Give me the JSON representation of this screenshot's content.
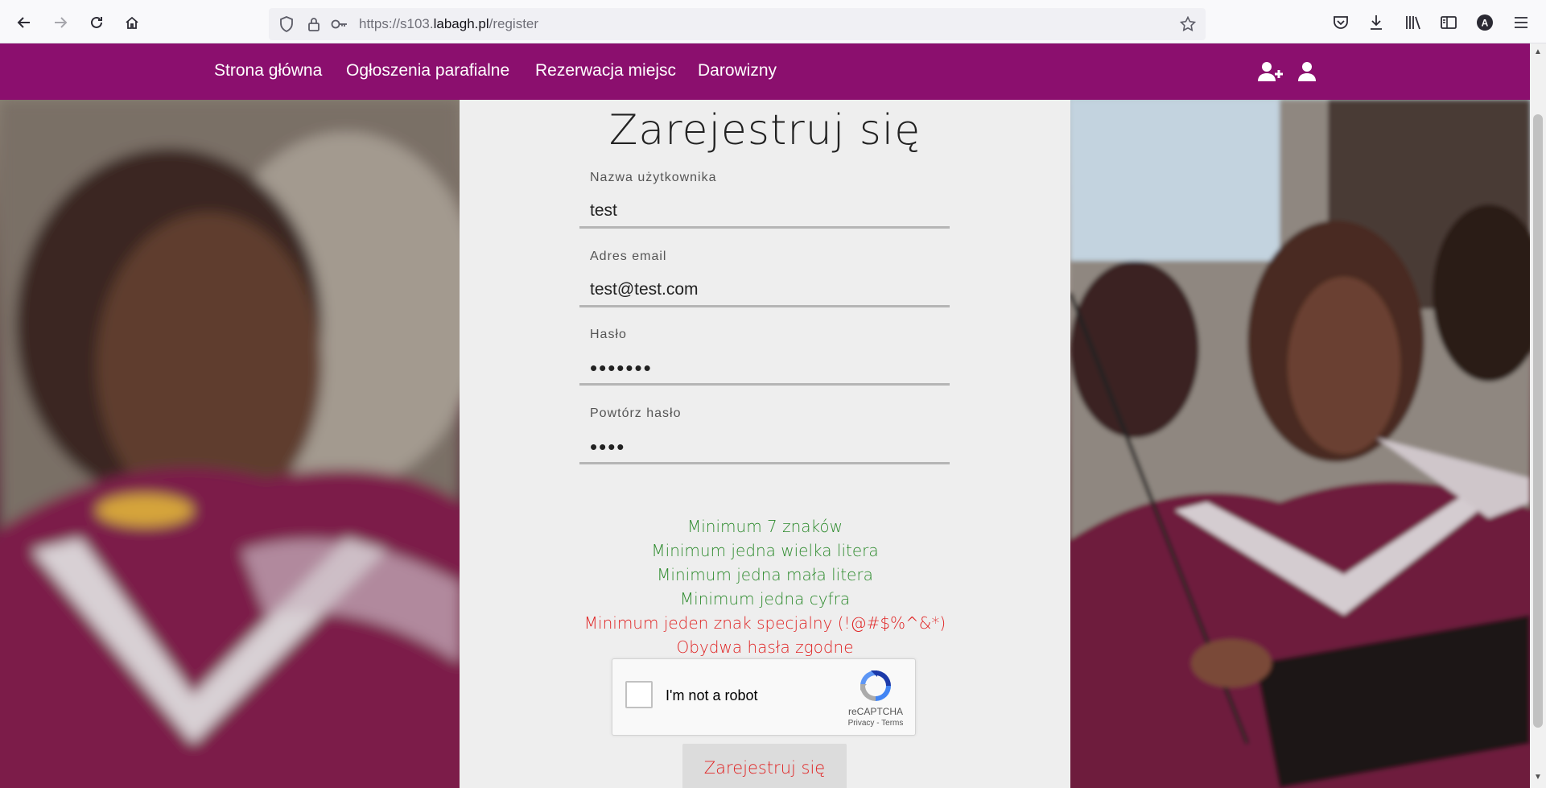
{
  "browser": {
    "url_prefix": "https://s103.",
    "url_domain": "labagh.pl",
    "url_path": "/register"
  },
  "nav": {
    "links": [
      "Strona główna",
      "Ogłoszenia parafialne",
      "Rezerwacja miejsc",
      "Darowizny"
    ],
    "icons": [
      "user-plus-icon",
      "user-icon"
    ],
    "brand_color": "#8b0f6e"
  },
  "form": {
    "title": "Zarejestruj się",
    "fields": [
      {
        "label": "Nazwa użytkownika",
        "value": "test"
      },
      {
        "label": "Adres email",
        "value": "test@test.com"
      },
      {
        "label": "Hasło",
        "value": "•••••••"
      },
      {
        "label": "Powtórz hasło",
        "value": "••••"
      }
    ],
    "rules": [
      {
        "text": "Minimum 7 znaków",
        "status": "ok"
      },
      {
        "text": "Minimum jedna wielka litera",
        "status": "ok"
      },
      {
        "text": "Minimum jedna mała litera",
        "status": "ok"
      },
      {
        "text": "Minimum jedna cyfra",
        "status": "ok"
      },
      {
        "text": "Minimum jeden znak specjalny (!@#$%^&*)",
        "status": "bad"
      },
      {
        "text": "Obydwa hasła zgodne",
        "status": "bad"
      }
    ],
    "ok_color": "#2e8b2e",
    "bad_color": "#e02424",
    "captcha": {
      "label": "I'm not a robot",
      "brand": "reCAPTCHA",
      "terms": "Privacy - Terms"
    },
    "submit_label": "Zarejestruj się"
  }
}
